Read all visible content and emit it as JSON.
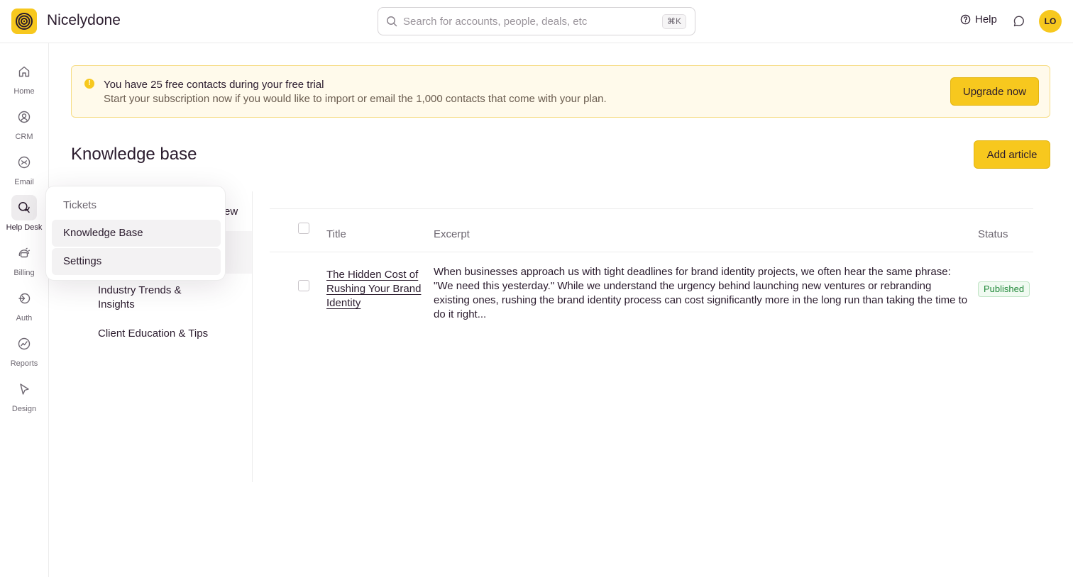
{
  "app": {
    "name": "Nicelydone",
    "brand_color": "#f7c81e"
  },
  "search": {
    "placeholder": "Search for accounts, people, deals, etc",
    "shortcut": "⌘K"
  },
  "header": {
    "help_label": "Help",
    "avatar_initials": "LO"
  },
  "nav": {
    "items": [
      {
        "label": "Home",
        "icon": "home-icon"
      },
      {
        "label": "CRM",
        "icon": "user-circle-icon"
      },
      {
        "label": "Email",
        "icon": "mail-icon"
      },
      {
        "label": "Help Desk",
        "icon": "chat-bubbles-icon",
        "active": true
      },
      {
        "label": "Billing",
        "icon": "billing-icon"
      },
      {
        "label": "Auth",
        "icon": "auth-icon"
      },
      {
        "label": "Reports",
        "icon": "chart-icon"
      },
      {
        "label": "Design",
        "icon": "cursor-icon"
      }
    ]
  },
  "banner": {
    "title": "You have 25 free contacts during your free trial",
    "subtitle": "Start your subscription now if you would like to import or email the 1,000 contacts that come with your plan.",
    "button": "Upgrade now"
  },
  "page": {
    "title": "Knowledge base",
    "add_button": "Add article"
  },
  "categories": {
    "peek_text": "ew",
    "items": [
      "Industry Trends & Insights",
      "Client Education & Tips"
    ]
  },
  "table": {
    "headers": {
      "title": "Title",
      "excerpt": "Excerpt",
      "status": "Status"
    },
    "rows": [
      {
        "title": "The Hidden Cost of Rushing Your Brand Identity",
        "excerpt": "When businesses approach us with tight deadlines for brand identity projects, we often hear the same phrase: \"We need this yesterday.\" While we understand the urgency behind launching new ventures or rebranding existing ones, rushing the brand identity process can cost significantly more in the long run than taking the time to do it right...",
        "status": "Published"
      }
    ]
  },
  "popover": {
    "heading": "Tickets",
    "items": [
      "Knowledge Base",
      "Settings"
    ]
  }
}
